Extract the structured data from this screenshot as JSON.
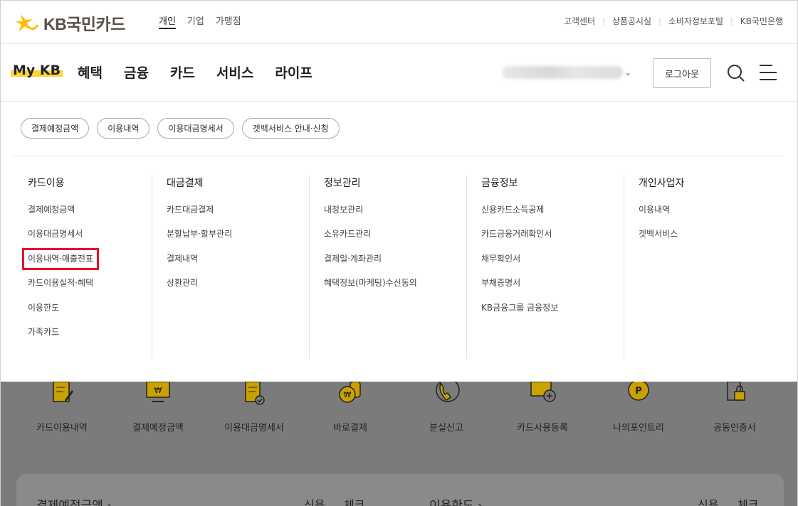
{
  "brand": {
    "name": "KB국민카드",
    "star_color": "#ffbc00"
  },
  "segments": [
    {
      "label": "개인",
      "active": true
    },
    {
      "label": "기업",
      "active": false
    },
    {
      "label": "가맹점",
      "active": false
    }
  ],
  "util_links": [
    "고객센터",
    "상품공시실",
    "소비자정보포털",
    "KB국민은행"
  ],
  "nav": {
    "mykb": "My KB",
    "items": [
      "혜택",
      "금융",
      "카드",
      "서비스",
      "라이프"
    ],
    "logout": "로그아웃",
    "accent": "#ffcc00"
  },
  "chips": [
    "결제예정금액",
    "이용내역",
    "이용대금명세서",
    "겟백서비스 안내·신청"
  ],
  "columns": [
    {
      "title": "카드이용",
      "items": [
        "결제예정금액",
        "이용대금명세서",
        "이용내역·매출전표",
        "카드이용실적·혜택",
        "이용한도",
        "가족카드"
      ]
    },
    {
      "title": "대금결제",
      "items": [
        "카드대금결제",
        "분할납부·할부관리",
        "결제내역",
        "상환관리"
      ]
    },
    {
      "title": "정보관리",
      "items": [
        "내정보관리",
        "소유카드관리",
        "결제일·계좌관리",
        "혜택정보(마케팅)수신동의"
      ]
    },
    {
      "title": "금융정보",
      "items": [
        "신용카드소득공제",
        "카드금융거래확인서",
        "채무확인서",
        "부채증명서",
        "KB금융그룹 금융정보"
      ]
    },
    {
      "title": "개인사업자",
      "items": [
        "이용내역",
        "겟백서비스"
      ]
    }
  ],
  "highlight_color": "#e8102a",
  "quick_menu": [
    "카드이용내역",
    "결제예정금액",
    "이용대금명세서",
    "바로결제",
    "분실신고",
    "카드사용등록",
    "나의포인트리",
    "공동인증서"
  ],
  "bottom_card": {
    "left_title": "결제예정금액",
    "left_tabs": [
      "신용",
      "체크"
    ],
    "right_title": "이용한도",
    "right_tabs": [
      "신용",
      "체크"
    ]
  }
}
